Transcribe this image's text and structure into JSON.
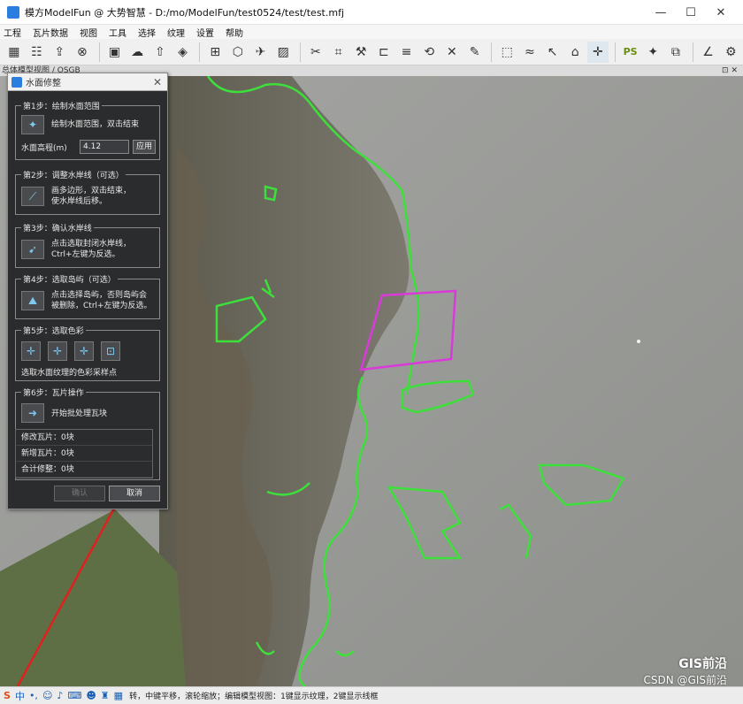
{
  "window": {
    "title": "模方ModelFun @ 大势智慧 - D:/mo/ModelFun/test0524/test/test.mfj",
    "controls": {
      "minimize": "—",
      "maximize": "☐",
      "close": "✕"
    }
  },
  "menu": [
    "工程",
    "瓦片数据",
    "视图",
    "工具",
    "选择",
    "纹理",
    "设置",
    "帮助"
  ],
  "toolbar": {
    "groups": [
      [
        "grid-icon",
        "dataset-icon",
        "export-icon",
        "close-circle-icon"
      ],
      [
        "stop-icon",
        "cloud-icon",
        "cloud-upload-icon",
        "layers-icon"
      ],
      [
        "four-grid-icon",
        "cube-icon",
        "plane-icon",
        "image-icon"
      ],
      [
        "scissors-icon",
        "crop-icon",
        "flatten-icon",
        "bridge-icon",
        "road-icon",
        "rotate-icon",
        "cut-plane-icon",
        "paint-icon"
      ],
      [
        "select-rect-icon",
        "water-icon",
        "cursor-icon",
        "bucket-icon",
        "move-icon"
      ],
      [
        "ps-icon",
        "texture-icon",
        "copy-icon"
      ],
      [
        "measure-icon",
        "gear-icon"
      ]
    ],
    "ps_label": "PS"
  },
  "subbar": {
    "label": "总体模型视图 / OSGB",
    "dock_icons": "⊡ ✕"
  },
  "panel": {
    "title": "水面修整",
    "step1": {
      "label": "第1步：绘制水面范围",
      "desc": [
        "绘制水面范围，双击结束"
      ],
      "height_label": "水面高程(m)",
      "height_value": "4.12",
      "apply": "应用"
    },
    "step2": {
      "label": "第2步：调整水岸线（可选）",
      "desc": [
        "画多边形，双击结束，",
        "使水岸线后移。"
      ]
    },
    "step3": {
      "label": "第3步：确认水岸线",
      "desc": [
        "点击选取封闭水岸线，",
        "Ctrl+左键为反选。"
      ]
    },
    "step4": {
      "label": "第4步：选取岛屿（可选）",
      "desc": [
        "点击选择岛屿，否则岛屿会",
        "被删除，Ctrl+左键为反选。"
      ]
    },
    "step5": {
      "label": "第5步：选取色彩",
      "desc": [
        "选取水面纹理的色彩采样点"
      ]
    },
    "step6": {
      "label": "第6步：瓦片操作",
      "desc": [
        "开始批处理瓦块"
      ],
      "stats": [
        "修改瓦片：0块",
        "新增瓦片：0块",
        "合计修整：0块"
      ]
    },
    "ok": "确认",
    "cancel": "取消"
  },
  "statusbar": {
    "text": "转，中键平移，滚轮缩放；编辑模型视图：1键显示纹理，2键显示线框",
    "ime": "S",
    "ime_mode": "中"
  },
  "watermark": {
    "line1": "GIS前沿",
    "line2": "CSDN @GIS前沿"
  },
  "colors": {
    "water_boundary": "#3de03a",
    "selection_polygon": "#d93ad9",
    "panel_bg": "#2b2c2e",
    "accent_link": "#e02020"
  }
}
